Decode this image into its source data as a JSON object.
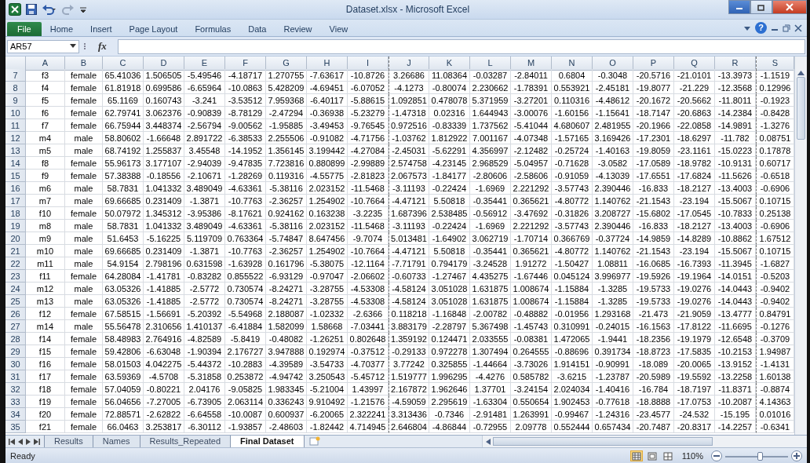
{
  "window": {
    "title": "Dataset.xlsx - Microsoft Excel"
  },
  "ribbon_tabs": [
    {
      "label": "File",
      "kind": "file"
    },
    {
      "label": "Home",
      "kind": "tab"
    },
    {
      "label": "Insert",
      "kind": "tab"
    },
    {
      "label": "Page Layout",
      "kind": "tab"
    },
    {
      "label": "Formulas",
      "kind": "tab"
    },
    {
      "label": "Data",
      "kind": "tab"
    },
    {
      "label": "Review",
      "kind": "tab"
    },
    {
      "label": "View",
      "kind": "tab"
    }
  ],
  "help": "?",
  "formula_bar": {
    "name_box": "AR57",
    "function_label": "fx"
  },
  "sheet": {
    "columns": [
      "A",
      "B",
      "C",
      "D",
      "E",
      "F",
      "G",
      "H",
      "I",
      "J",
      "K",
      "L",
      "M",
      "N",
      "O",
      "P",
      "Q",
      "R",
      "S"
    ],
    "rows": [
      {
        "number": "7",
        "cells": [
          "f3",
          "female",
          "65.41036",
          "1.506505",
          "-5.49546",
          "-4.18717",
          "1.270755",
          "-7.63617",
          "-10.8726",
          "3.26686",
          "11.08364",
          "-0.03287",
          "-2.84011",
          "0.6804",
          "-0.3048",
          "-20.5716",
          "-21.0101",
          "-13.3973",
          "-1.1519"
        ]
      },
      {
        "number": "8",
        "cells": [
          "f4",
          "female",
          "61.81918",
          "0.699586",
          "-6.65964",
          "-10.0863",
          "5.428209",
          "-4.69451",
          "-6.07052",
          "-4.1273",
          "-0.80074",
          "2.230662",
          "-1.78391",
          "0.553921",
          "-2.45181",
          "-19.8077",
          "-21.229",
          "-12.3568",
          "0.12996"
        ]
      },
      {
        "number": "9",
        "cells": [
          "f5",
          "female",
          "65.1169",
          "0.160743",
          "-3.241",
          "-3.53512",
          "7.959368",
          "-6.40117",
          "-5.88615",
          "1.092851",
          "0.478078",
          "5.371959",
          "-3.27201",
          "0.110316",
          "-4.48612",
          "-20.1672",
          "-20.5662",
          "-11.8011",
          "-0.1923"
        ]
      },
      {
        "number": "10",
        "cells": [
          "f6",
          "female",
          "62.79741",
          "3.062376",
          "-0.90839",
          "-8.78129",
          "-2.47294",
          "-0.36938",
          "-5.23279",
          "-1.47318",
          "0.02316",
          "1.644943",
          "-3.00076",
          "-1.60156",
          "-1.15641",
          "-18.7147",
          "-20.6863",
          "-14.2384",
          "-0.8428"
        ]
      },
      {
        "number": "11",
        "cells": [
          "f7",
          "female",
          "66.75944",
          "3.448374",
          "-2.56794",
          "-9.00562",
          "-1.95885",
          "-3.49453",
          "-9.76545",
          "0.972516",
          "-0.83339",
          "1.737562",
          "-5.41044",
          "4.680607",
          "2.481955",
          "-20.1966",
          "-22.0858",
          "-14.9891",
          "-1.3276"
        ]
      },
      {
        "number": "12",
        "cells": [
          "m4",
          "male",
          "58.80602",
          "-1.66648",
          "2.891722",
          "-6.38533",
          "2.255506",
          "-0.91082",
          "-4.71756",
          "-1.03762",
          "1.812922",
          "7.001167",
          "-4.07348",
          "-1.57165",
          "3.169426",
          "-17.2301",
          "-18.6297",
          "-11.782",
          "0.08751"
        ]
      },
      {
        "number": "13",
        "cells": [
          "m5",
          "male",
          "68.74192",
          "1.255837",
          "3.45548",
          "-14.1952",
          "1.356145",
          "3.199442",
          "-4.27084",
          "-2.45031",
          "-5.62291",
          "4.356997",
          "-2.12482",
          "-0.25724",
          "-1.40163",
          "-19.8059",
          "-23.1161",
          "-15.0223",
          "0.17878"
        ]
      },
      {
        "number": "14",
        "cells": [
          "f8",
          "female",
          "55.96173",
          "3.177107",
          "-2.94039",
          "-9.47835",
          "7.723816",
          "0.880899",
          "-2.99889",
          "2.574758",
          "-4.23145",
          "2.968529",
          "-5.04957",
          "-0.71628",
          "-3.0582",
          "-17.0589",
          "-18.9782",
          "-10.9131",
          "0.60717"
        ]
      },
      {
        "number": "15",
        "cells": [
          "f9",
          "female",
          "57.38388",
          "-0.18556",
          "-2.10671",
          "-1.28269",
          "0.119316",
          "-4.55775",
          "-2.81823",
          "2.067573",
          "-1.84177",
          "-2.80606",
          "-2.58606",
          "-0.91059",
          "-4.13039",
          "-17.6551",
          "-17.6824",
          "-11.5626",
          "-0.6518"
        ]
      },
      {
        "number": "16",
        "cells": [
          "m6",
          "male",
          "58.7831",
          "1.041332",
          "3.489049",
          "-4.63361",
          "-5.38116",
          "2.023152",
          "-11.5468",
          "-3.11193",
          "-0.22424",
          "-1.6969",
          "2.221292",
          "-3.57743",
          "2.390446",
          "-16.833",
          "-18.2127",
          "-13.4003",
          "-0.6906"
        ]
      },
      {
        "number": "17",
        "cells": [
          "m7",
          "male",
          "69.66685",
          "0.231409",
          "-1.3871",
          "-10.7763",
          "-2.36257",
          "1.254902",
          "-10.7664",
          "-4.47121",
          "5.50818",
          "-0.35441",
          "0.365621",
          "-4.80772",
          "1.140762",
          "-21.1543",
          "-23.194",
          "-15.5067",
          "0.10715"
        ]
      },
      {
        "number": "18",
        "cells": [
          "f10",
          "female",
          "50.07972",
          "1.345312",
          "-3.95386",
          "-8.17621",
          "0.924162",
          "0.163238",
          "-3.2235",
          "1.687396",
          "2.538485",
          "-0.56912",
          "-3.47692",
          "-0.31826",
          "3.208727",
          "-15.6802",
          "-17.0545",
          "-10.7833",
          "0.25138"
        ]
      },
      {
        "number": "19",
        "cells": [
          "m8",
          "male",
          "58.7831",
          "1.041332",
          "3.489049",
          "-4.63361",
          "-5.38116",
          "2.023152",
          "-11.5468",
          "-3.11193",
          "-0.22424",
          "-1.6969",
          "2.221292",
          "-3.57743",
          "2.390446",
          "-16.833",
          "-18.2127",
          "-13.4003",
          "-0.6906"
        ]
      },
      {
        "number": "20",
        "cells": [
          "m9",
          "male",
          "51.6453",
          "-5.16225",
          "5.119709",
          "0.763364",
          "-5.74847",
          "8.647456",
          "-9.7074",
          "5.013481",
          "-1.64902",
          "3.062719",
          "-1.70714",
          "0.366769",
          "-0.37724",
          "-14.9859",
          "-14.8289",
          "-10.8862",
          "1.67512"
        ]
      },
      {
        "number": "21",
        "cells": [
          "m10",
          "male",
          "69.66685",
          "0.231409",
          "-1.3871",
          "-10.7763",
          "-2.36257",
          "1.254902",
          "-10.7664",
          "-4.47121",
          "5.50818",
          "-0.35441",
          "0.365621",
          "-4.80772",
          "1.140762",
          "-21.1543",
          "-23.194",
          "-15.5067",
          "0.10715"
        ]
      },
      {
        "number": "22",
        "cells": [
          "m11",
          "male",
          "54.9154",
          "2.798196",
          "0.631598",
          "-1.63928",
          "0.161796",
          "-5.38075",
          "-12.1164",
          "-7.71791",
          "0.794179",
          "-3.24528",
          "1.91272",
          "-1.50427",
          "1.08811",
          "-16.0685",
          "-16.7393",
          "-11.3945",
          "-1.6827"
        ]
      },
      {
        "number": "23",
        "cells": [
          "f11",
          "female",
          "64.28084",
          "-1.41781",
          "-0.83282",
          "0.855522",
          "-6.93129",
          "-0.97047",
          "-2.06602",
          "-0.60733",
          "-1.27467",
          "4.435275",
          "-1.67446",
          "0.045124",
          "3.996977",
          "-19.5926",
          "-19.1964",
          "-14.0151",
          "-0.5203"
        ]
      },
      {
        "number": "24",
        "cells": [
          "m12",
          "male",
          "63.05326",
          "-1.41885",
          "-2.5772",
          "0.730574",
          "-8.24271",
          "-3.28755",
          "-4.53308",
          "-4.58124",
          "3.051028",
          "1.631875",
          "1.008674",
          "-1.15884",
          "-1.3285",
          "-19.5733",
          "-19.0276",
          "-14.0443",
          "-0.9402"
        ]
      },
      {
        "number": "25",
        "cells": [
          "m13",
          "male",
          "63.05326",
          "-1.41885",
          "-2.5772",
          "0.730574",
          "-8.24271",
          "-3.28755",
          "-4.53308",
          "-4.58124",
          "3.051028",
          "1.631875",
          "1.008674",
          "-1.15884",
          "-1.3285",
          "-19.5733",
          "-19.0276",
          "-14.0443",
          "-0.9402"
        ]
      },
      {
        "number": "26",
        "cells": [
          "f12",
          "female",
          "67.58515",
          "-1.56691",
          "-5.20392",
          "-5.54968",
          "2.188087",
          "-1.02332",
          "-2.6366",
          "0.118218",
          "-1.16848",
          "-2.00782",
          "-0.48882",
          "-0.01956",
          "1.293168",
          "-21.473",
          "-21.9059",
          "-13.4777",
          "0.84791"
        ]
      },
      {
        "number": "27",
        "cells": [
          "m14",
          "male",
          "55.56478",
          "2.310656",
          "1.410137",
          "-6.41884",
          "1.582099",
          "1.58668",
          "-7.03441",
          "3.883179",
          "-2.28797",
          "5.367498",
          "-1.45743",
          "0.310991",
          "-0.24015",
          "-16.1563",
          "-17.8122",
          "-11.6695",
          "-0.1276"
        ]
      },
      {
        "number": "28",
        "cells": [
          "f14",
          "female",
          "58.48983",
          "2.764916",
          "-4.82589",
          "-5.8419",
          "-0.48082",
          "-1.26251",
          "0.802648",
          "1.359192",
          "0.124471",
          "2.033555",
          "-0.08381",
          "1.472065",
          "-1.9441",
          "-18.2356",
          "-19.1979",
          "-12.6548",
          "-0.3709"
        ]
      },
      {
        "number": "29",
        "cells": [
          "f15",
          "female",
          "59.42806",
          "-6.63048",
          "-1.90394",
          "2.176727",
          "3.947888",
          "0.192974",
          "-0.37512",
          "-0.29133",
          "0.972278",
          "1.307494",
          "0.264555",
          "-0.88696",
          "0.391734",
          "-18.8723",
          "-17.5835",
          "-10.2153",
          "1.94987"
        ]
      },
      {
        "number": "30",
        "cells": [
          "f16",
          "female",
          "58.01503",
          "4.042275",
          "-5.44372",
          "-10.2883",
          "-4.39589",
          "-3.54733",
          "-4.70377",
          "3.77242",
          "0.325855",
          "-1.44664",
          "-3.73026",
          "1.914151",
          "-0.90991",
          "-18.089",
          "-20.0065",
          "-13.9152",
          "-1.4131"
        ]
      },
      {
        "number": "31",
        "cells": [
          "f17",
          "female",
          "63.59369",
          "-4.5708",
          "-5.31858",
          "0.253872",
          "-4.94742",
          "3.250543",
          "-5.45712",
          "1.519777",
          "1.996295",
          "-4.4276",
          "0.585782",
          "-3.6215",
          "-1.23787",
          "-20.5989",
          "-19.5592",
          "-13.2258",
          "1.60138"
        ]
      },
      {
        "number": "32",
        "cells": [
          "f18",
          "female",
          "57.04059",
          "-0.80221",
          "2.04176",
          "-9.05825",
          "1.983345",
          "-5.21004",
          "1.43997",
          "2.167872",
          "1.962646",
          "1.37701",
          "-3.24154",
          "2.024034",
          "-1.40416",
          "-16.784",
          "-18.7197",
          "-11.8371",
          "-0.8874"
        ]
      },
      {
        "number": "33",
        "cells": [
          "f19",
          "female",
          "56.04656",
          "-7.27005",
          "-6.73905",
          "2.063114",
          "0.336243",
          "9.910492",
          "-1.21576",
          "-4.59059",
          "2.295619",
          "-1.63304",
          "0.550654",
          "1.902453",
          "-0.77618",
          "-18.8888",
          "-17.0753",
          "-10.2087",
          "4.14363"
        ]
      },
      {
        "number": "34",
        "cells": [
          "f20",
          "female",
          "72.88571",
          "-2.62822",
          "-6.64558",
          "-10.0087",
          "0.600937",
          "-6.20065",
          "2.322241",
          "3.313436",
          "-0.7346",
          "-2.91481",
          "1.263991",
          "-0.99467",
          "-1.24316",
          "-23.4577",
          "-24.532",
          "-15.195",
          "0.01016"
        ]
      },
      {
        "number": "35",
        "cells": [
          "f21",
          "female",
          "66.0463",
          "3.253817",
          "-6.30112",
          "-1.93857",
          "-2.48603",
          "-1.82442",
          "4.714945",
          "2.646804",
          "-4.86844",
          "-0.72955",
          "2.09778",
          "0.552444",
          "0.657434",
          "-20.7487",
          "-20.8317",
          "-14.2257",
          "-0.6341"
        ]
      }
    ]
  },
  "sheet_tabs": [
    {
      "label": "Results",
      "selected": false
    },
    {
      "label": "Names",
      "selected": false
    },
    {
      "label": "Results_Repeated",
      "selected": false
    },
    {
      "label": "Final Dataset",
      "selected": true
    }
  ],
  "status_bar": {
    "text": "Ready",
    "views": [
      {
        "kind": "normal",
        "selected": true
      },
      {
        "kind": "page_layout",
        "selected": false
      },
      {
        "kind": "page_break",
        "selected": false
      }
    ],
    "zoom": "110%",
    "zoom_slider": {
      "level": 0.55
    }
  }
}
